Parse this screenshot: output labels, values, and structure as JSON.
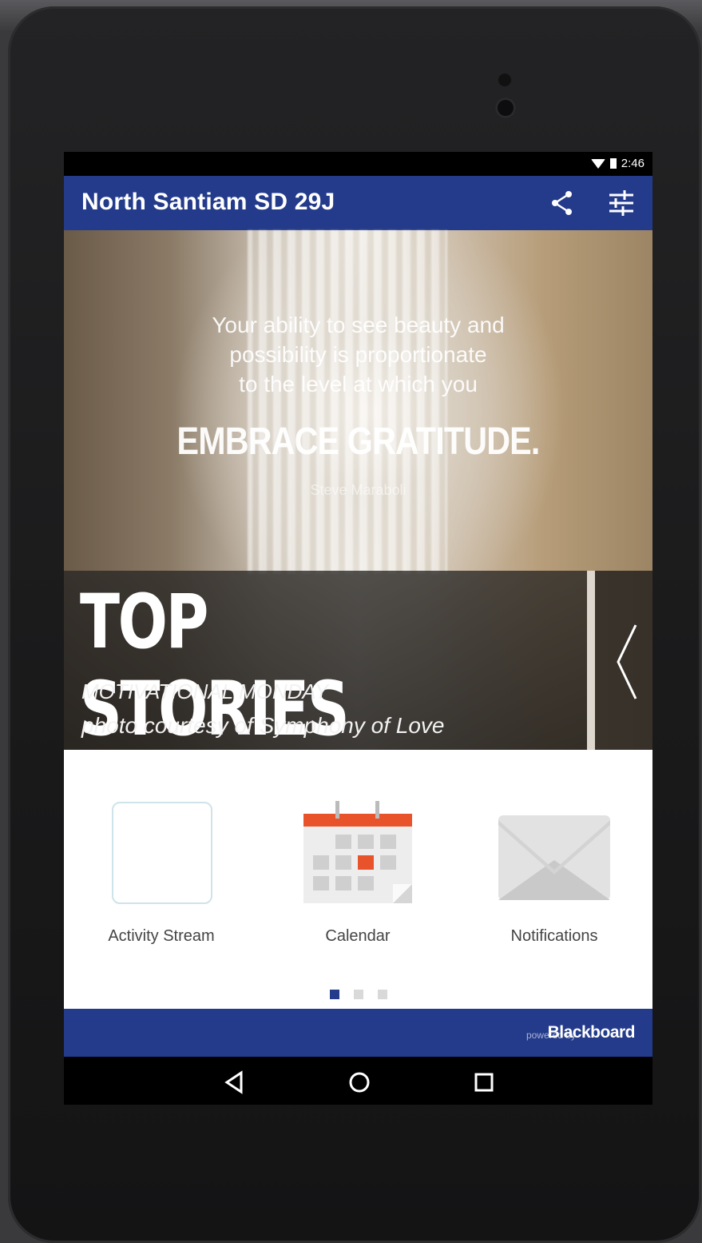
{
  "status_bar": {
    "time": "2:46"
  },
  "app_bar": {
    "title": "North Santiam SD 29J"
  },
  "hero": {
    "quote_lines": [
      "Your ability to see beauty and",
      "possibility is proportionate",
      "to the level at which you"
    ],
    "quote_emphasis": "EMBRACE GRATITUDE.",
    "quote_author": "Steve Maraboli",
    "banner_title": "TOP STORIES",
    "headline": "MOTIVATIONAL MONDAY",
    "caption": "photo courtesy of Symphony of Love"
  },
  "tiles": [
    {
      "label": "Activity Stream",
      "icon": "activity-stream-icon"
    },
    {
      "label": "Calendar",
      "icon": "calendar-icon"
    },
    {
      "label": "Notifications",
      "icon": "envelope-icon"
    }
  ],
  "pager": {
    "pages": 3,
    "active": 1
  },
  "footer": {
    "powered_by": "powered by",
    "brand": "Blackboard"
  },
  "colors": {
    "primary": "#233b8a",
    "calendar_accent": "#e8532c"
  }
}
